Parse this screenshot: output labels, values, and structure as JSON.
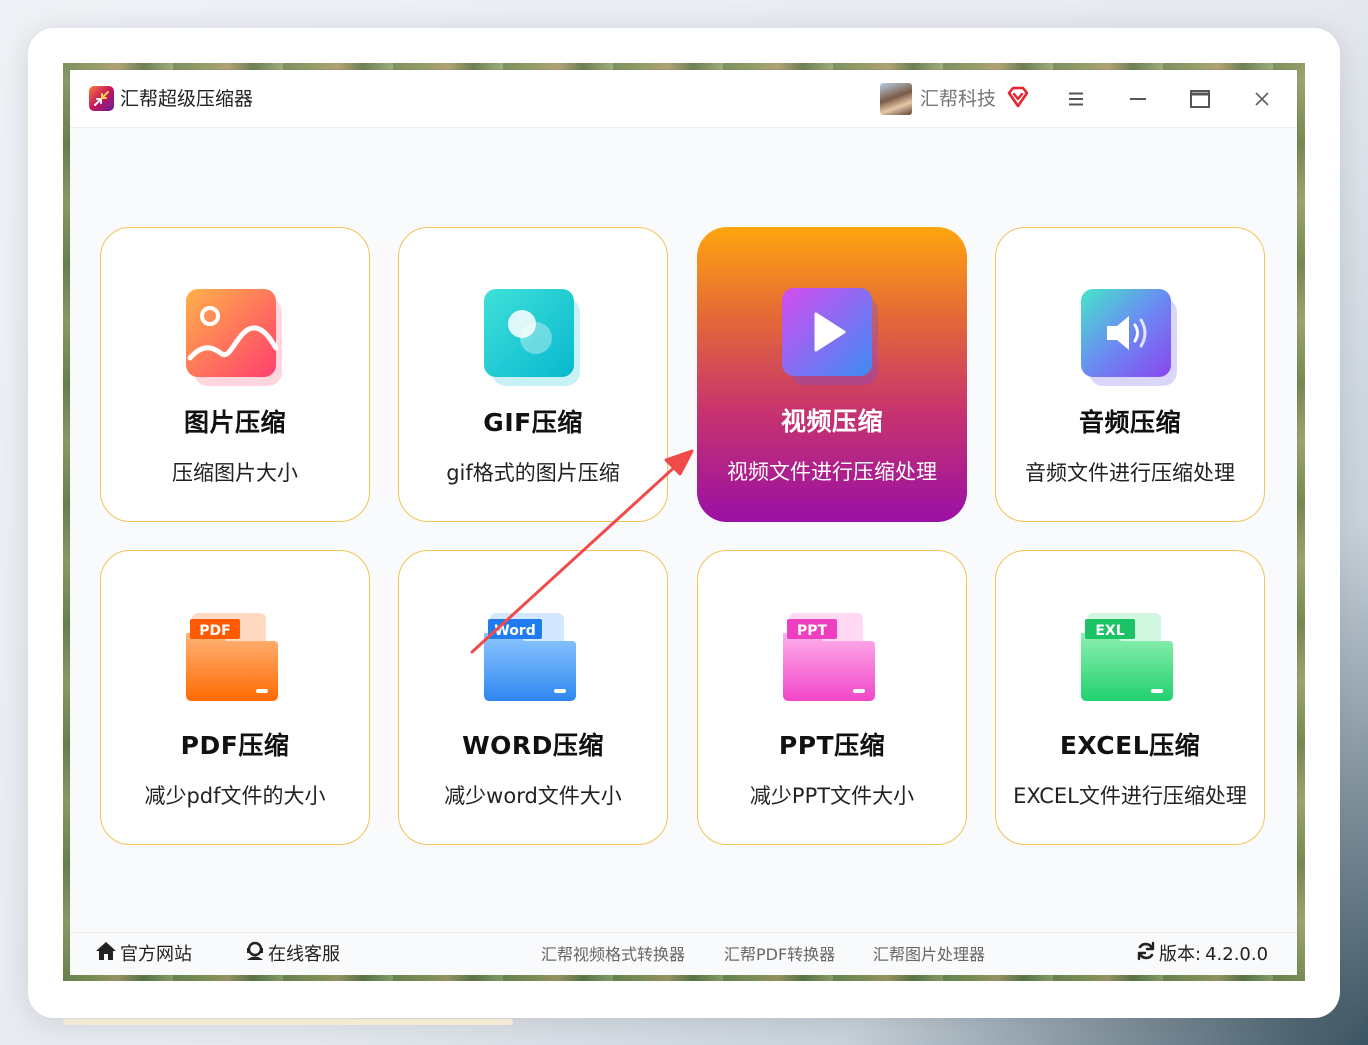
{
  "window": {
    "title": "汇帮超级压缩器",
    "user_name": "汇帮科技",
    "icons": [
      "app-logo-icon",
      "avatar",
      "vip-diamond-icon",
      "menu-icon",
      "minimize-icon",
      "maximize-icon",
      "close-icon"
    ]
  },
  "cards": [
    {
      "title": "图片压缩",
      "desc": "压缩图片大小",
      "icon": "image-icon",
      "active": false
    },
    {
      "title": "GIF压缩",
      "desc": "gif格式的图片压缩",
      "icon": "gif-icon",
      "active": false
    },
    {
      "title": "视频压缩",
      "desc": "视频文件进行压缩处理",
      "icon": "video-play-icon",
      "active": true
    },
    {
      "title": "音频压缩",
      "desc": "音频文件进行压缩处理",
      "icon": "audio-speaker-icon",
      "active": false
    },
    {
      "title": "PDF压缩",
      "desc": "减少pdf文件的大小",
      "icon": "pdf-folder-icon",
      "badge": "PDF",
      "active": false
    },
    {
      "title": "WORD压缩",
      "desc": "减少word文件大小",
      "icon": "word-folder-icon",
      "badge": "Word",
      "active": false
    },
    {
      "title": "PPT压缩",
      "desc": "减少PPT文件大小",
      "icon": "ppt-folder-icon",
      "badge": "PPT",
      "active": false
    },
    {
      "title": "EXCEL压缩",
      "desc": "EXCEL文件进行压缩处理",
      "icon": "excel-folder-icon",
      "badge": "EXL",
      "active": false
    }
  ],
  "footer": {
    "website": "官方网站",
    "support": "在线客服",
    "links": [
      "汇帮视频格式转换器",
      "汇帮PDF转换器",
      "汇帮图片处理器"
    ],
    "version_label": "版本:",
    "version": "4.2.0.0"
  },
  "colors": {
    "card_border": "#f5c25a",
    "active_gradient_top": "#ffa50e",
    "active_gradient_bottom": "#9a10a4",
    "arrow": "#f04a4a",
    "vip": "#e8232e"
  }
}
